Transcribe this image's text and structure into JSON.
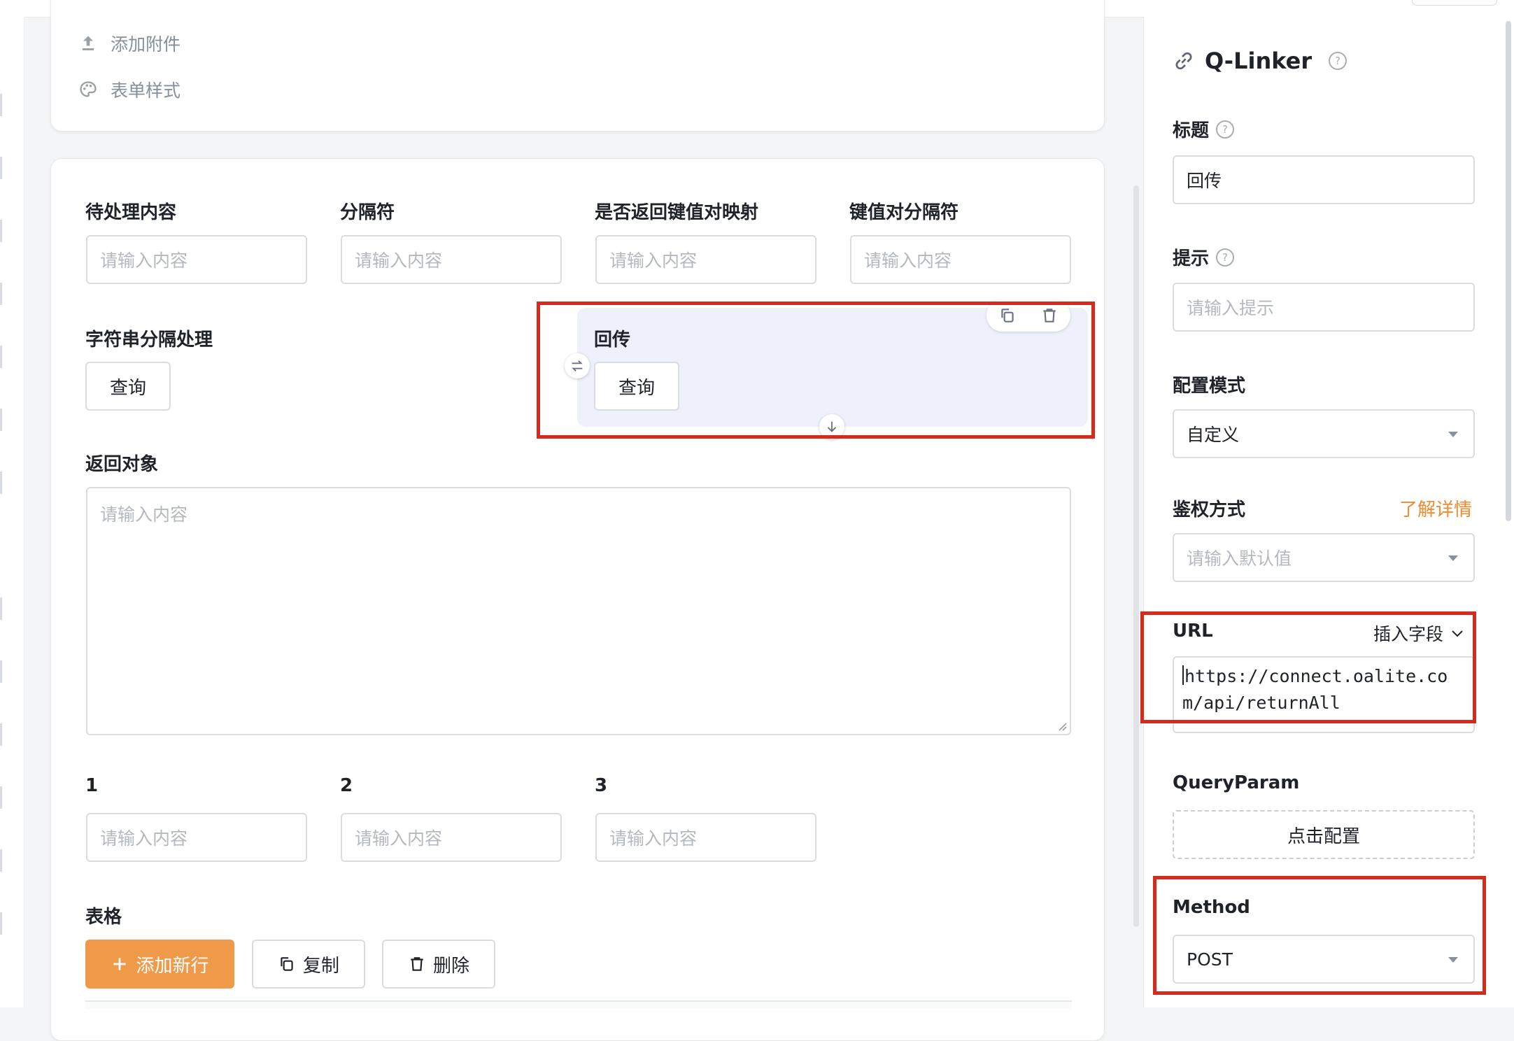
{
  "sidebar_menu": [
    {
      "label": "添加附件",
      "icon": "upload-icon"
    },
    {
      "label": "表单样式",
      "icon": "palette-icon"
    }
  ],
  "form": {
    "fields_row1": [
      {
        "label": "待处理内容",
        "placeholder": "请输入内容"
      },
      {
        "label": "分隔符",
        "placeholder": "请输入内容"
      },
      {
        "label": "是否返回键值对映射",
        "placeholder": "请输入内容"
      },
      {
        "label": "键值对分隔符",
        "placeholder": "请输入内容"
      }
    ],
    "string_split": {
      "label": "字符串分隔处理",
      "button": "查询"
    },
    "callback_block": {
      "label": "回传",
      "button": "查询"
    },
    "return_object": {
      "label": "返回对象",
      "placeholder": "请输入内容"
    },
    "fields_row2": [
      {
        "label": "1",
        "placeholder": "请输入内容"
      },
      {
        "label": "2",
        "placeholder": "请输入内容"
      },
      {
        "label": "3",
        "placeholder": "请输入内容"
      }
    ],
    "table": {
      "label": "表格",
      "add_row": "添加新行",
      "copy": "复制",
      "delete": "删除"
    }
  },
  "panel": {
    "title": "Q-Linker",
    "title_label": "标题",
    "title_value": "回传",
    "hint_label": "提示",
    "hint_placeholder": "请输入提示",
    "config_mode_label": "配置模式",
    "config_mode_value": "自定义",
    "auth_label": "鉴权方式",
    "auth_link": "了解详情",
    "auth_placeholder": "请输入默认值",
    "url_label": "URL",
    "insert_field": "插入字段",
    "url_value": "https://connect.oalite.com/api/returnAll",
    "query_label": "QueryParam",
    "query_button": "点击配置",
    "method_label": "Method",
    "method_value": "POST"
  },
  "colors": {
    "accent_orange": "#ef9a49",
    "highlight_red": "#d42b1f",
    "selected_block": "#eef1fb"
  }
}
